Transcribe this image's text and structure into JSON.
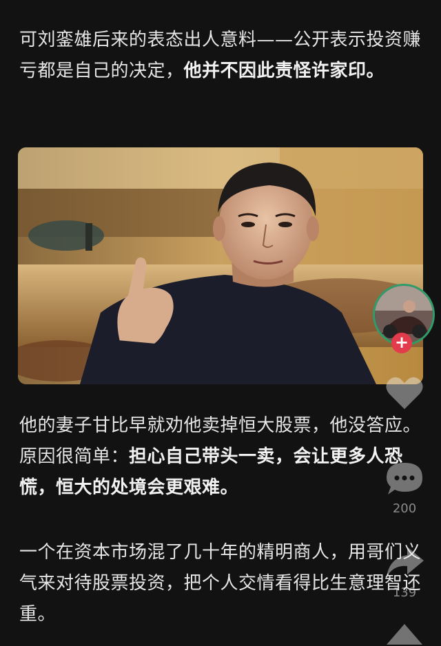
{
  "article": {
    "p1_a": "可刘銮雄后来的表态出人意料——公开表示投资赚亏都是自己的决定，",
    "p1_b": "他并不因此责怪许家印。",
    "p2_a": "他的妻子甘比早就劝他卖掉恒大股票，他没答应。原因很简单：",
    "p2_b": "担心自己带头一卖，会让更多人恐慌，恒大的处境会更艰难。",
    "p3": "一个在资本市场混了几十年的精明商人，用哥们义气来对待股票投资，把个人交情看得比生意理智还重。"
  },
  "sidebar": {
    "follow_symbol": "+",
    "comment_count": "200",
    "share_count": "139"
  },
  "colors": {
    "background": "#121212",
    "text": "#e6e6e6",
    "avatar_ring": "#2e9d6a",
    "follow_badge": "#e23b4c"
  },
  "icons": [
    "heart-icon",
    "comment-icon",
    "share-icon",
    "more-icon"
  ]
}
